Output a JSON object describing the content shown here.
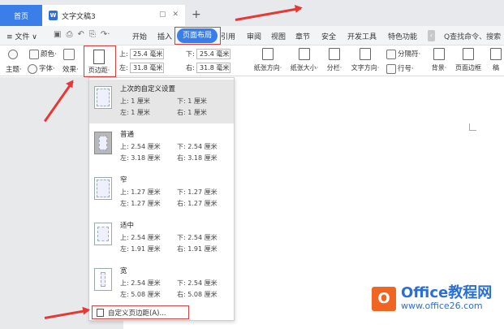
{
  "tabs": {
    "home": "首页",
    "doc_icon": "W",
    "doc_title": "文字文稿3",
    "doc_controls": [
      "▢",
      "✕"
    ],
    "new_tab": "+"
  },
  "menu": {
    "file": "≡ 文件 ∨",
    "quick_icons": [
      "▣",
      "⎙",
      "↶",
      "⎘",
      "↷·"
    ],
    "items": [
      "开始",
      "插入",
      "页面布局",
      "引用",
      "审阅",
      "视图",
      "章节",
      "安全",
      "开发工具",
      "特色功能"
    ],
    "search": "Q查找命令、搜索"
  },
  "ribbon": {
    "row1": [
      "颜色·",
      "主题·",
      "字体·",
      "效果·"
    ],
    "margin_label": "页边距·",
    "margins": {
      "top_label": "上:",
      "top": "25.4 毫米",
      "bottom_label": "下:",
      "bottom": "25.4 毫米",
      "left_label": "左:",
      "left": "31.8 毫米",
      "right_label": "右:",
      "right": "31.8 毫米"
    },
    "tools": [
      "纸张方向·",
      "纸张大小·",
      "分栏·",
      "文字方向·",
      "行号·",
      "背景·",
      "页面边框",
      "稿"
    ],
    "break": "分隔符·"
  },
  "dropdown": {
    "items": [
      {
        "name": "上次的自定义设置",
        "top": "上: 1 厘米",
        "bottom": "下: 1 厘米",
        "left": "左: 1 厘米",
        "right": "右: 1 厘米"
      },
      {
        "name": "普通",
        "top": "上: 2.54 厘米",
        "bottom": "下: 2.54 厘米",
        "left": "左: 3.18 厘米",
        "right": "右: 3.18 厘米"
      },
      {
        "name": "窄",
        "top": "上: 1.27 厘米",
        "bottom": "下: 1.27 厘米",
        "left": "左: 1.27 厘米",
        "right": "右: 1.27 厘米"
      },
      {
        "name": "适中",
        "top": "上: 2.54 厘米",
        "bottom": "下: 2.54 厘米",
        "left": "左: 1.91 厘米",
        "right": "右: 1.91 厘米"
      },
      {
        "name": "宽",
        "top": "上: 2.54 厘米",
        "bottom": "下: 2.54 厘米",
        "left": "左: 5.08 厘米",
        "right": "右: 5.08 厘米"
      }
    ],
    "custom": "自定义页边距(A)..."
  },
  "watermark": {
    "logo": "O",
    "name": "Office教程网",
    "url": "www.office26.com"
  },
  "colors": {
    "accent": "#3b7de9",
    "highlight": "#e53935",
    "brand": "#f06522"
  }
}
